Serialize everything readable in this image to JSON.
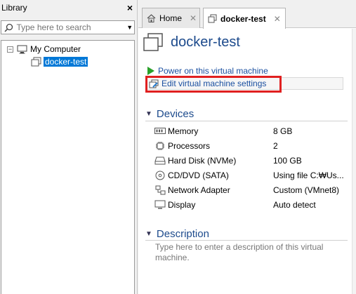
{
  "library": {
    "title": "Library",
    "close_glyph": "×",
    "search_placeholder": "Type here to search",
    "tree": {
      "root_toggle": "−",
      "root_label": "My Computer",
      "child_label": "docker-test"
    }
  },
  "tabs": [
    {
      "label": "Home",
      "close": "✕"
    },
    {
      "label": "docker-test",
      "close": "✕"
    }
  ],
  "vm": {
    "title": "docker-test"
  },
  "actions": {
    "power_on": "Power on this virtual machine",
    "edit_settings": "Edit virtual machine settings"
  },
  "devices": {
    "heading": "Devices",
    "items": [
      {
        "icon": "memory-icon",
        "name": "Memory",
        "value": "8 GB"
      },
      {
        "icon": "processor-icon",
        "name": "Processors",
        "value": "2"
      },
      {
        "icon": "hard-disk-icon",
        "name": "Hard Disk (NVMe)",
        "value": "100 GB"
      },
      {
        "icon": "cd-dvd-icon",
        "name": "CD/DVD (SATA)",
        "value": "Using file C:₩Us..."
      },
      {
        "icon": "network-adapter-icon",
        "name": "Network Adapter",
        "value": "Custom (VMnet8)"
      },
      {
        "icon": "display-icon",
        "name": "Display",
        "value": "Auto detect"
      }
    ]
  },
  "description": {
    "heading": "Description",
    "placeholder": "Type here to enter a description of this virtual machine."
  },
  "colors": {
    "link": "#1a4fa0",
    "heading": "#1c4a8c",
    "selection": "#0078d7",
    "highlight_box": "#e02020",
    "power_green": "#2aa12a"
  }
}
